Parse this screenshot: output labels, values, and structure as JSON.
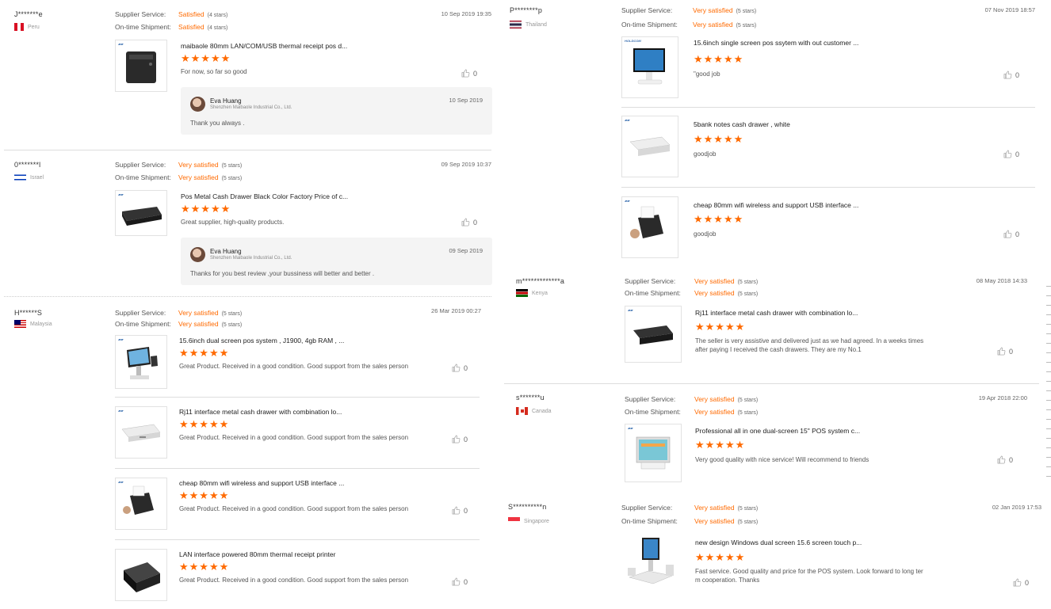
{
  "labels": {
    "supplier_service": "Supplier Service:",
    "on_time_shipment": "On-time Shipment:"
  },
  "rating_color": "#ff6a00",
  "stars": "★★★★★",
  "left": {
    "r1": {
      "user": "J*******e",
      "country": "Peru",
      "date": "10 Sep 2019 19:35",
      "service": "Satisfied",
      "service_stars": "(4 stars)",
      "shipment": "Satisfied",
      "shipment_stars": "(4 stars)",
      "items": [
        {
          "title": "maibaole 80mm LAN/COM/USB thermal receipt pos d...",
          "comment": "For now, so far so good",
          "likes": "0"
        }
      ],
      "reply": {
        "name": "Eva Huang",
        "company": "Shenzhen Maibaole Industrial Co., Ltd.",
        "date": "10 Sep 2019",
        "text": "Thank you always ."
      }
    },
    "r2": {
      "user": "0*******l",
      "country": "Israel",
      "date": "09 Sep 2019 10:37",
      "service": "Very satisfied",
      "service_stars": "(5 stars)",
      "shipment": "Very satisfied",
      "shipment_stars": "(5 stars)",
      "items": [
        {
          "title": "Pos Metal Cash Drawer Black Color Factory Price of c...",
          "comment": "Great supplier, high-quality products.",
          "likes": "0"
        }
      ],
      "reply": {
        "name": "Eva Huang",
        "company": "Shenzhen Maibaole Industrial Co., Ltd.",
        "date": "09 Sep 2019",
        "text": "Thanks for you best review ,your bussiness will better and better ."
      }
    },
    "r3": {
      "user": "H******S",
      "country": "Malaysia",
      "date": "26 Mar 2019 00:27",
      "service": "Very satisfied",
      "service_stars": "(5 stars)",
      "shipment": "Very satisfied",
      "shipment_stars": "(5 stars)",
      "items": [
        {
          "title": "15.6inch dual screen pos system , J1900, 4gb RAM , ...",
          "comment": "Great Product. Received in a good condition. Good support from the sales person",
          "likes": "0"
        },
        {
          "title": "Rj11 interface metal cash drawer with combination lo...",
          "comment": "Great Product. Received in a good condition. Good support from the sales person",
          "likes": "0"
        },
        {
          "title": "cheap 80mm wifi wireless and support USB interface ...",
          "comment": "Great Product. Received in a good condition. Good support from the sales person",
          "likes": "0"
        },
        {
          "title": "LAN interface powered 80mm thermal receipt printer",
          "comment": "Great Product. Received in a good condition. Good support from the sales person",
          "likes": "0"
        }
      ]
    }
  },
  "right": {
    "r1": {
      "user": "P********p",
      "country": "Thailand",
      "date": "07 Nov 2019 18:57",
      "service": "Very satisfied",
      "service_stars": "(5 stars)",
      "shipment": "Very satisfied",
      "shipment_stars": "(5 stars)",
      "items": [
        {
          "title": "15.6inch single screen pos ssytem with out customer ...",
          "comment": "\"good job",
          "likes": "0"
        },
        {
          "title": "5bank notes cash drawer , white",
          "comment": "goodjob",
          "likes": "0"
        },
        {
          "title": "cheap 80mm wifi wireless and support USB interface ...",
          "comment": "goodjob",
          "likes": "0"
        }
      ]
    },
    "r2": {
      "user": "m*************a",
      "country": "Kenya",
      "date": "08 May 2018 14:33",
      "service": "Very satisfied",
      "service_stars": "(5 stars)",
      "shipment": "Very satisfied",
      "shipment_stars": "(5 stars)",
      "items": [
        {
          "title": "Rj11 interface metal cash drawer with combination lo...",
          "comment": "The seller is very assistive and delivered just as we had agreed. In a weeks times",
          "comment2": "after paying I received the cash drawers. They are my No.1",
          "likes": "0"
        }
      ]
    },
    "r3": {
      "user": "s*******u",
      "country": "Canada",
      "date": "19 Apr 2018 22:00",
      "service": "Very satisfied",
      "service_stars": "(5 stars)",
      "shipment": "Very satisfied",
      "shipment_stars": "(5 stars)",
      "items": [
        {
          "title": "Professional all in one dual-screen 15\" POS system c...",
          "comment": "Very good quality with nice service!  Will recommend to friends",
          "likes": "0"
        }
      ]
    },
    "r4": {
      "user": "S**********n",
      "country": "Singapore",
      "date": "02 Jan 2019 17:53",
      "service": "Very satisfied",
      "service_stars": "(5 stars)",
      "shipment": "Very satisfied",
      "shipment_stars": "(5 stars)",
      "items": [
        {
          "title": "new design Windows dual screen 15.6 screen touch p...",
          "comment": "Fast service. Good quality and price for the POS system. Look forward to long ter",
          "comment2": "m cooperation. Thanks",
          "likes": "0"
        }
      ]
    }
  }
}
